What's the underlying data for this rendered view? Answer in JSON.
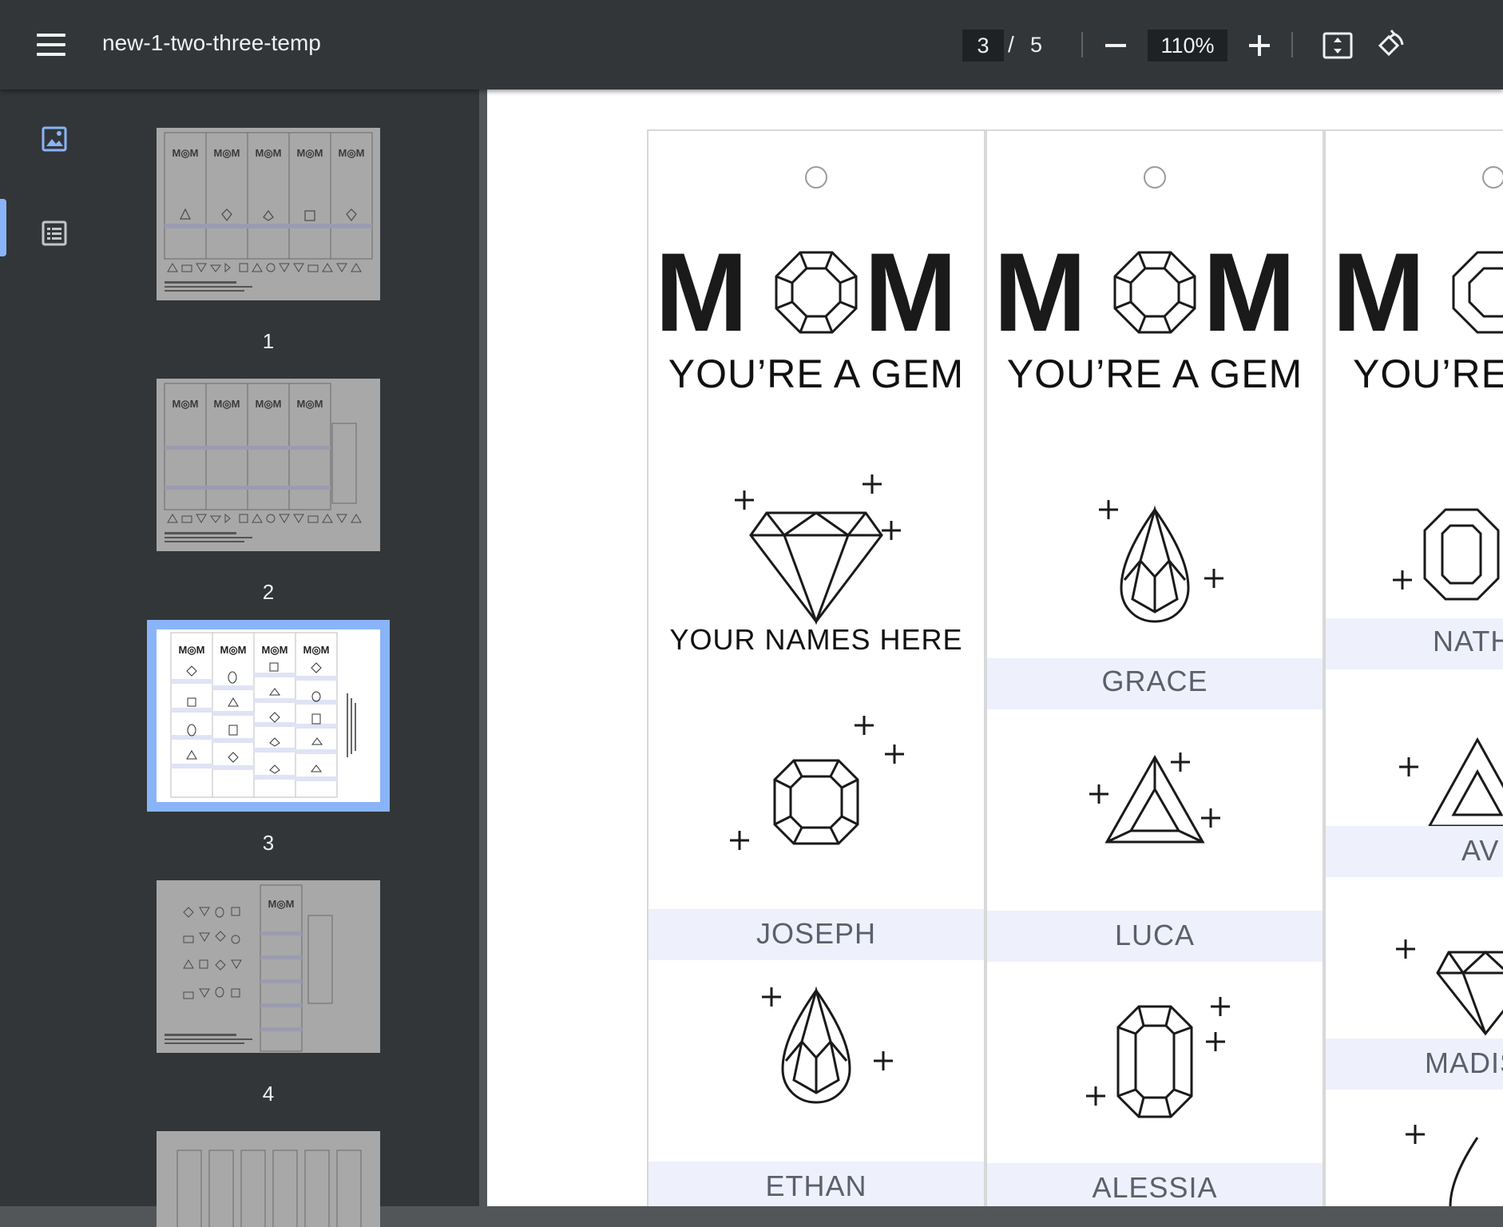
{
  "toolbar": {
    "title": "new-1-two-three-temp",
    "current_page": "3",
    "page_separator": "/",
    "total_pages": "5",
    "zoom": "110%",
    "icons": [
      "menu-icon",
      "zoom-out-icon",
      "zoom-in-icon",
      "fit-page-icon",
      "rotate-icon"
    ]
  },
  "sidebar": {
    "view_icons": [
      "thumbnails-icon",
      "outline-icon"
    ],
    "thumbnails": [
      {
        "label": "1"
      },
      {
        "label": "2"
      },
      {
        "label": "3"
      },
      {
        "label": "4"
      }
    ]
  },
  "page": {
    "columns": [
      {
        "header_main": "M M",
        "header_sub": "YOU’RE A GEM",
        "entries": [
          {
            "name": "YOUR NAMES HERE",
            "gem": "diamond"
          },
          {
            "name": "JOSEPH",
            "gem": "cushion"
          },
          {
            "name": "ETHAN",
            "gem": "pear"
          }
        ]
      },
      {
        "header_main": "M M",
        "header_sub": "YOU’RE A GEM",
        "entries": [
          {
            "name": "GRACE",
            "gem": "pear"
          },
          {
            "name": "LUCA",
            "gem": "trillion"
          },
          {
            "name": "ALESSIA",
            "gem": "emerald"
          }
        ]
      },
      {
        "header_main": "M M",
        "header_sub": "YOU’RE",
        "entries": [
          {
            "name": "NATH",
            "gem": "emerald"
          },
          {
            "name": "AV",
            "gem": "trillion"
          },
          {
            "name": "MADIS",
            "gem": "diamond"
          }
        ]
      }
    ]
  },
  "colors": {
    "toolbar_bg": "#323639",
    "accent": "#8ab4f8",
    "name_band": "#eef1fb"
  }
}
